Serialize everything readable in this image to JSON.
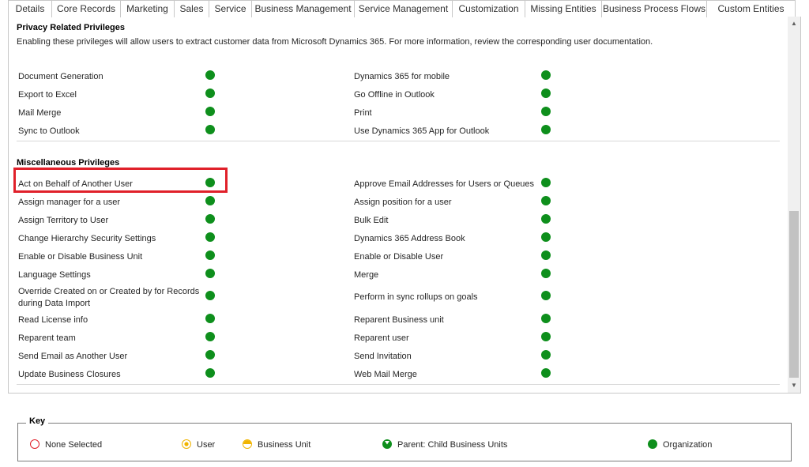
{
  "tabs": [
    "Details",
    "Core Records",
    "Marketing",
    "Sales",
    "Service",
    "Business Management",
    "Service Management",
    "Customization",
    "Missing Entities",
    "Business Process Flows",
    "Custom Entities"
  ],
  "active_tab": "Business Management",
  "privacy": {
    "title": "Privacy Related Privileges",
    "description": "Enabling these privileges will allow users to extract customer data from Microsoft Dynamics 365. For more information, review the corresponding user documentation.",
    "left": [
      "Document Generation",
      "Export to Excel",
      "Mail Merge",
      "Sync to Outlook"
    ],
    "right": [
      "Dynamics 365 for mobile",
      "Go Offline in Outlook",
      "Print",
      "Use Dynamics 365 App for Outlook"
    ]
  },
  "misc": {
    "title": "Miscellaneous Privileges",
    "left": [
      "Act on Behalf of Another User",
      "Assign manager for a user",
      "Assign Territory to User",
      "Change Hierarchy Security Settings",
      "Enable or Disable Business Unit",
      "Language Settings",
      "Override Created on or Created by for Records during Data Import",
      "Read License info",
      "Reparent team",
      "Send Email as Another User",
      "Update Business Closures"
    ],
    "right": [
      "Approve Email Addresses for Users or Queues",
      "Assign position for a user",
      "Bulk Edit",
      "Dynamics 365 Address Book",
      "Enable or Disable User",
      "Merge",
      "Perform in sync rollups on goals",
      "Reparent Business unit",
      "Reparent user",
      "Send Invitation",
      "Web Mail Merge"
    ]
  },
  "privilege_level": "Organization",
  "key": {
    "title": "Key",
    "items": [
      "None Selected",
      "User",
      "Business Unit",
      "Parent: Child Business Units",
      "Organization"
    ]
  },
  "colors": {
    "organization": "#0e8f1c",
    "highlight": "#e0202a",
    "user": "#f0b400"
  }
}
